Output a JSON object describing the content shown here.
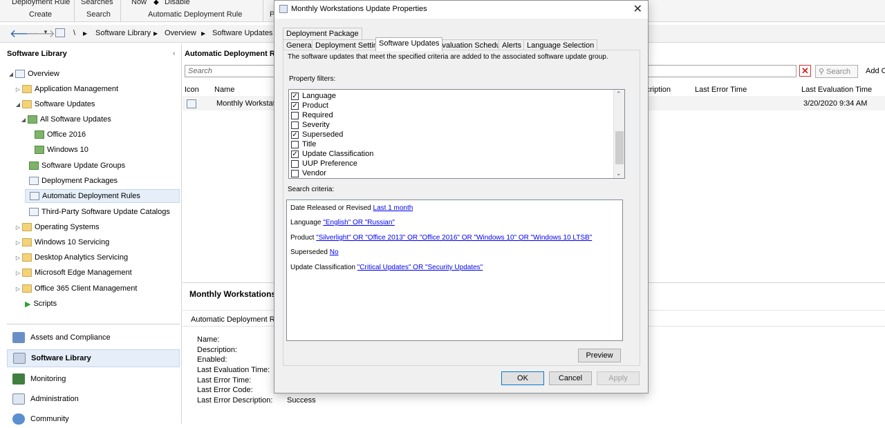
{
  "ribbon": {
    "top_labels": [
      "Deployment Rule",
      "Searches",
      "Now",
      "Disable"
    ],
    "groups": [
      "Create",
      "Search",
      "Automatic Deployment Rule",
      "P"
    ]
  },
  "address": {
    "crumbs": [
      "\\",
      "Software Library",
      "Overview",
      "Software Updates"
    ]
  },
  "nav": {
    "title": "Software Library",
    "items": [
      {
        "label": "Overview"
      },
      {
        "label": "Application Management"
      },
      {
        "label": "Software Updates"
      },
      {
        "label": "All Software Updates"
      },
      {
        "label": "Office 2016"
      },
      {
        "label": "Windows 10"
      },
      {
        "label": "Software Update Groups"
      },
      {
        "label": "Deployment Packages"
      },
      {
        "label": "Automatic Deployment Rules"
      },
      {
        "label": "Third-Party Software Update Catalogs"
      },
      {
        "label": "Operating Systems"
      },
      {
        "label": "Windows 10 Servicing"
      },
      {
        "label": "Desktop Analytics Servicing"
      },
      {
        "label": "Microsoft Edge Management"
      },
      {
        "label": "Office 365 Client Management"
      },
      {
        "label": "Scripts"
      }
    ],
    "workspaces": [
      "Assets and Compliance",
      "Software Library",
      "Monitoring",
      "Administration",
      "Community"
    ]
  },
  "main": {
    "title": "Automatic Deployment Rul",
    "search_placeholder": "Search",
    "search_button": "Search",
    "add_criteria": "Add C",
    "columns": {
      "icon": "Icon",
      "name": "Name",
      "description": "scription",
      "last_error_time": "Last Error Time",
      "last_evaluation_time": "Last Evaluation Time"
    },
    "row": {
      "name": "Monthly Workstati",
      "last_evaluation_time": "3/20/2020 9:34 AM"
    },
    "details_title": "Monthly Workstations",
    "details_sub": "Automatic Deployment Ru",
    "details_fields": [
      "Name:",
      "Description:",
      "Enabled:",
      "Last Evaluation Time:",
      "Last Error Time:",
      "Last Error Code:",
      "Last Error Description:"
    ],
    "last_error_description_value": "Success"
  },
  "dialog": {
    "title": "Monthly Workstations Update Properties",
    "tabs_row1": [
      "Deployment Package"
    ],
    "tabs_row2": [
      "General",
      "Deployment Settings",
      "Software Updates",
      "Evaluation Schedule",
      "Alerts",
      "Language Selection"
    ],
    "active_tab": "Software Updates",
    "description": "The software updates that meet the specified criteria are added to the associated software update group.",
    "property_filters_label": "Property filters:",
    "property_filters": [
      {
        "label": "Language",
        "checked": true
      },
      {
        "label": "Product",
        "checked": true
      },
      {
        "label": "Required",
        "checked": false
      },
      {
        "label": "Severity",
        "checked": false
      },
      {
        "label": "Superseded",
        "checked": true
      },
      {
        "label": "Title",
        "checked": false
      },
      {
        "label": "Update Classification",
        "checked": true
      },
      {
        "label": "UUP Preference",
        "checked": false
      },
      {
        "label": "Vendor",
        "checked": false
      }
    ],
    "search_criteria_label": "Search criteria:",
    "criteria": [
      {
        "name": "Date Released or Revised",
        "value": "Last 1 month"
      },
      {
        "name": "Language",
        "value": "\"English\" OR \"Russian\""
      },
      {
        "name": "Product",
        "value": "\"Silverlight\" OR \"Office 2013\" OR \"Office 2016\" OR \"Windows 10\" OR \"Windows 10 LTSB\""
      },
      {
        "name": "Superseded",
        "value": "No"
      },
      {
        "name": "Update Classification",
        "value": "\"Critical Updates\" OR \"Security Updates\""
      }
    ],
    "preview_label": "Preview",
    "ok_label": "OK",
    "cancel_label": "Cancel",
    "apply_label": "Apply"
  }
}
